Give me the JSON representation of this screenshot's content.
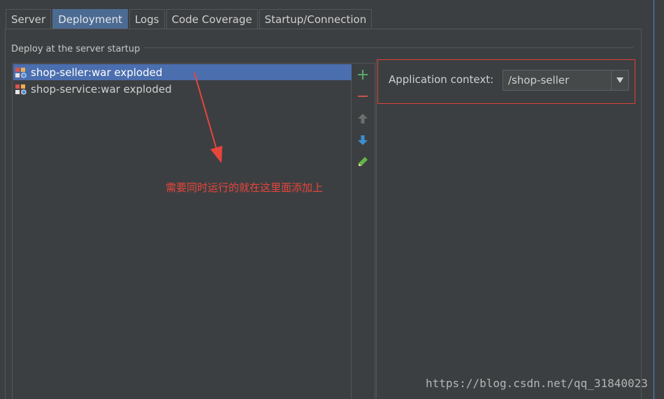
{
  "tabs": [
    {
      "label": "Server",
      "active": false
    },
    {
      "label": "Deployment",
      "active": true
    },
    {
      "label": "Logs",
      "active": false
    },
    {
      "label": "Code Coverage",
      "active": false
    },
    {
      "label": "Startup/Connection",
      "active": false
    }
  ],
  "deploy": {
    "section_title": "Deploy at the server startup",
    "artifacts": [
      {
        "label": "shop-seller:war exploded",
        "selected": true,
        "icon": "war-exploded-icon"
      },
      {
        "label": "shop-service:war exploded",
        "selected": false,
        "icon": "war-exploded-icon"
      }
    ],
    "toolbar": [
      {
        "name": "add-artifact-button",
        "icon": "plus-icon",
        "color": "#59a869"
      },
      {
        "name": "remove-artifact-button",
        "icon": "minus-icon",
        "color": "#c75450"
      },
      {
        "name": "move-up-button",
        "icon": "arrow-up-icon",
        "color": "#6e6e6e"
      },
      {
        "name": "move-down-button",
        "icon": "arrow-down-icon",
        "color": "#3d8fd1"
      },
      {
        "name": "edit-artifact-button",
        "icon": "pencil-icon",
        "color": "#62b543"
      }
    ]
  },
  "settings": {
    "context_label": "Application context:",
    "context_value": "/shop-seller"
  },
  "annotation": {
    "text": "需要同时运行的就在这里面添加上",
    "color": "#e8453c"
  },
  "watermark": "https://blog.csdn.net/qq_31840023",
  "colors": {
    "background": "#3c3f41",
    "selection": "#4b6eaf",
    "active_tab": "#4b6b93",
    "highlight_border": "#e0403a"
  }
}
